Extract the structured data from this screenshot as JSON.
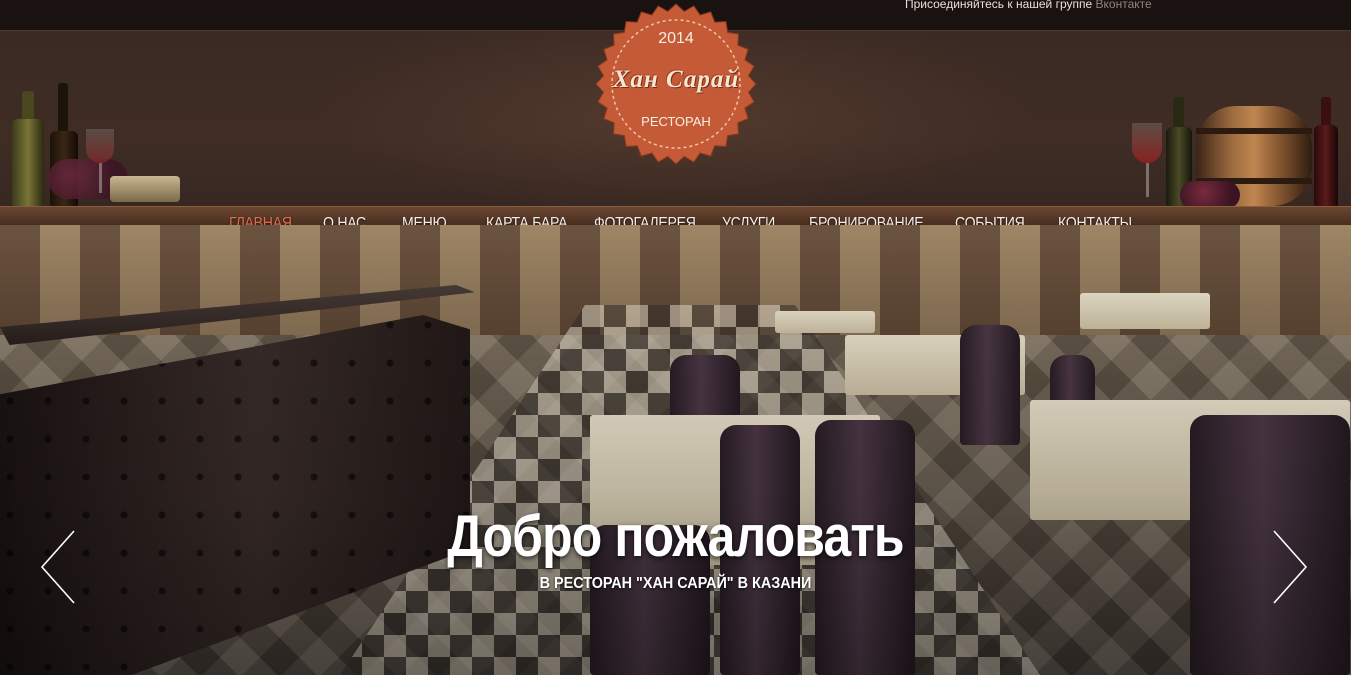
{
  "topbar": {
    "join_text": "Присоединяйтесь к нашей группе ",
    "join_link": "Вконтакте"
  },
  "logo": {
    "year": "2014",
    "name": "Хан Сарай",
    "subtitle": "РЕСТОРАН",
    "badge_color": "#c45a36"
  },
  "nav": {
    "items": [
      {
        "label": "ГЛАВНАЯ",
        "active": true
      },
      {
        "label": "О НАС"
      },
      {
        "label": "МЕНЮ"
      },
      {
        "label": "КАРТА БАРА"
      },
      {
        "label": "ФОТОГАЛЕРЕЯ"
      },
      {
        "label": "УСЛУГИ"
      },
      {
        "label": "БРОНИРОВАНИЕ"
      },
      {
        "label": "СОБЫТИЯ"
      },
      {
        "label": "КОНТАКТЫ"
      }
    ],
    "active_color": "#e06b4e"
  },
  "hero": {
    "title": "Добро пожаловать",
    "subtitle": "В РЕСТОРАН \"ХАН САРАЙ\" В КАЗАНИ",
    "prev_icon": "chevron-left-icon",
    "next_icon": "chevron-right-icon"
  }
}
